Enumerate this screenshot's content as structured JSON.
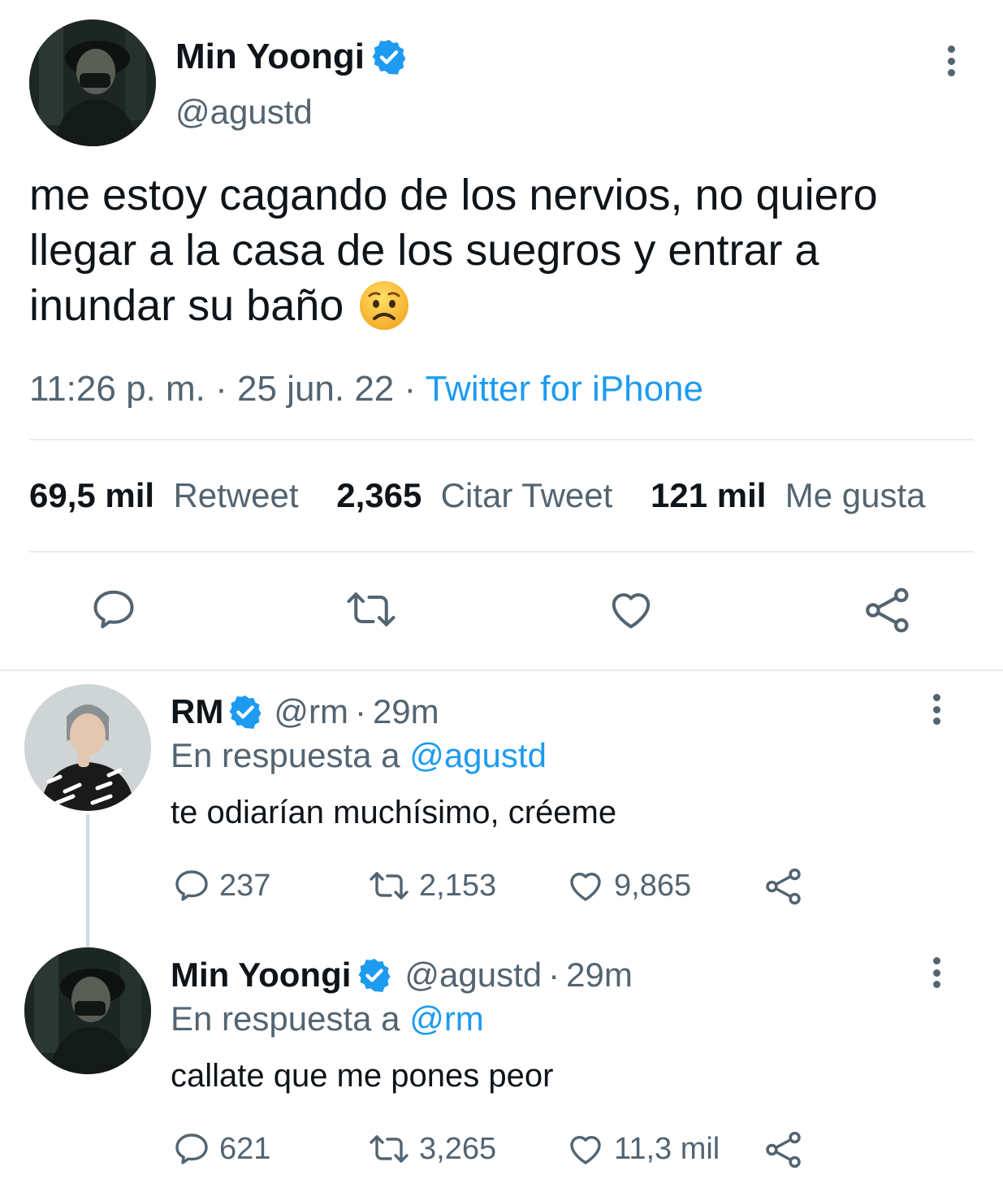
{
  "main_tweet": {
    "author_name": "Min Yoongi",
    "handle": "@agustd",
    "text_line1": "me estoy cagando de los nervios, no quiero",
    "text_line2": "llegar a la casa de los suegros y entrar a",
    "text_line3": "inundar su baño",
    "emoji": "😟",
    "time": "11:26 p. m.",
    "sep1": "·",
    "date": "25 jun. 22",
    "sep2": "·",
    "source": "Twitter for iPhone",
    "stats": {
      "retweets_count": "69,5 mil",
      "retweets_label": "Retweet",
      "quotes_count": "2,365",
      "quotes_label": "Citar Tweet",
      "likes_count": "121 mil",
      "likes_label": "Me gusta"
    }
  },
  "replies": [
    {
      "author_name": "RM",
      "handle": "@rm",
      "sep": "·",
      "time": "29m",
      "reply_prefix": "En respuesta a",
      "reply_to": "@agustd",
      "text": "te odiarían muchísimo, créeme",
      "replies": "237",
      "retweets": "2,153",
      "likes": "9,865"
    },
    {
      "author_name": "Min Yoongi",
      "handle": "@agustd",
      "sep": "·",
      "time": "29m",
      "reply_prefix": "En respuesta a",
      "reply_to": "@rm",
      "text": "callate que me pones peor",
      "replies": "621",
      "retweets": "3,265",
      "likes": "11,3 mil"
    }
  ],
  "colors": {
    "accent": "#1d9bf0",
    "muted": "#536471",
    "divider": "#e6ecf0"
  }
}
